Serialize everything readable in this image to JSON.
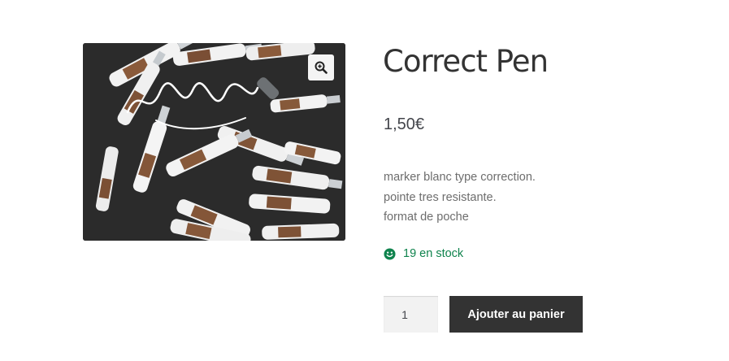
{
  "product": {
    "title": "Correct Pen",
    "price": "1,50€",
    "description_lines": [
      "marker blanc type correction.",
      "pointe tres resistante.",
      "format de poche"
    ],
    "stock_text": "19 en stock",
    "quantity_value": "1",
    "add_to_cart_label": "Ajouter au panier",
    "image_alt": "Correct Pen"
  },
  "icons": {
    "zoom": "magnifier-zoom-icon",
    "stock": "smile-icon"
  },
  "colors": {
    "stock_green": "#0f834d",
    "button_dark": "#333333",
    "image_background": "#2c2c2c"
  }
}
